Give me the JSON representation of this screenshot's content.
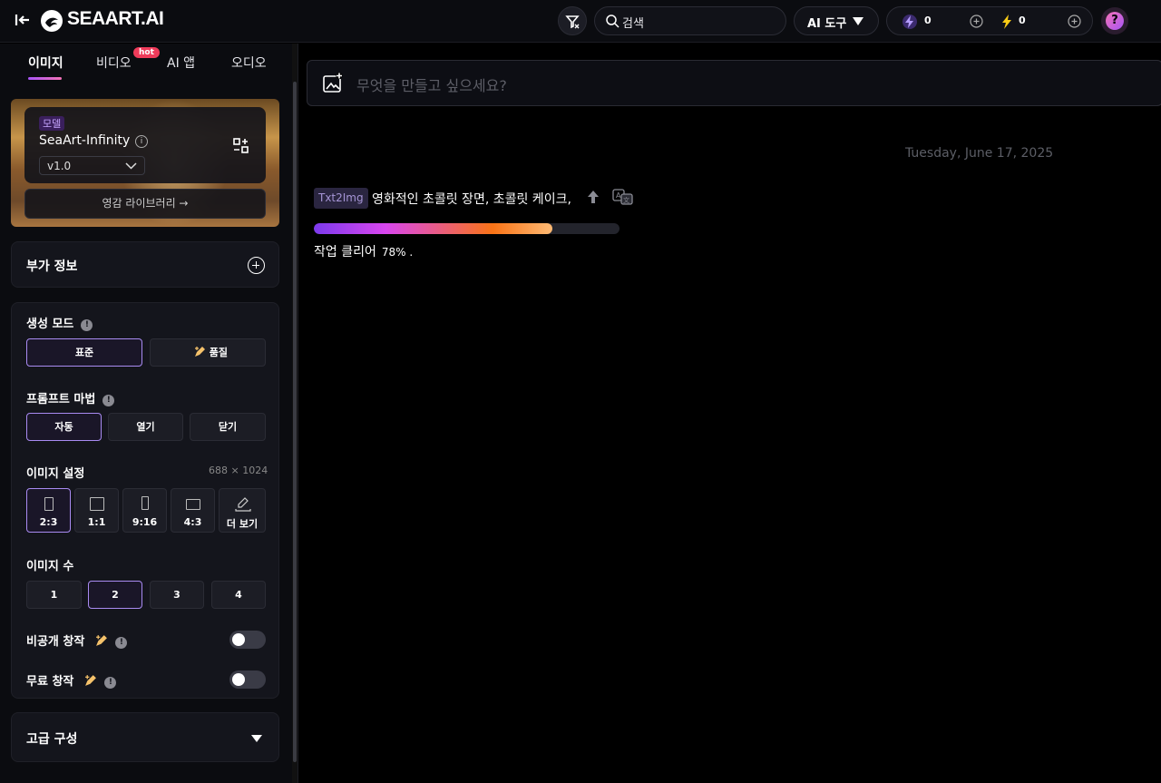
{
  "header": {
    "brand": "SEAART.AI",
    "search_label": "검색",
    "ai_tool_label": "AI 도구",
    "credit_a": "0",
    "credit_b": "0",
    "help_label": "?"
  },
  "tabs": [
    {
      "label": "이미지",
      "active": true
    },
    {
      "label": "비디오",
      "badge": "hot"
    },
    {
      "label": "AI 앱"
    },
    {
      "label": "오디오"
    }
  ],
  "model": {
    "tag": "모델",
    "name": "SeaArt-Infinity",
    "version": "v1.0",
    "library_label": "영감 라이브러리 →"
  },
  "extra_info": {
    "title": "부가 정보"
  },
  "generation_mode": {
    "title": "생성 모드",
    "options": [
      "표준",
      "품질"
    ],
    "selected": "표준"
  },
  "prompt_magic": {
    "title": "프롬프트 마법",
    "options": [
      "자동",
      "열기",
      "닫기"
    ],
    "selected": "자동"
  },
  "image_settings": {
    "title": "이미지 설정",
    "dimensions": "688 × 1024",
    "ratios": [
      "2:3",
      "1:1",
      "9:16",
      "4:3",
      "더 보기"
    ],
    "selected": "2:3"
  },
  "image_count": {
    "title": "이미지 수",
    "options": [
      "1",
      "2",
      "3",
      "4"
    ],
    "selected": "2"
  },
  "private_creation": {
    "label": "비공개 창작",
    "enabled": false
  },
  "free_creation": {
    "label": "무료 창작",
    "enabled": false
  },
  "advanced": {
    "title": "고급 구성"
  },
  "main": {
    "prompt_placeholder": "무엇을 만들고 싶으세요?",
    "date": "Tuesday, June 17, 2025",
    "task": {
      "type_badge": "Txt2Img",
      "prompt_text": "영화적인 초콜릿 장면, 초콜릿 케이크,",
      "progress": 0.78,
      "status_label": "작업 클리어",
      "percent_label": "78% ."
    }
  },
  "colors": {
    "accent": "#a98bf2",
    "background": "#000000",
    "panel": "#14151c"
  }
}
